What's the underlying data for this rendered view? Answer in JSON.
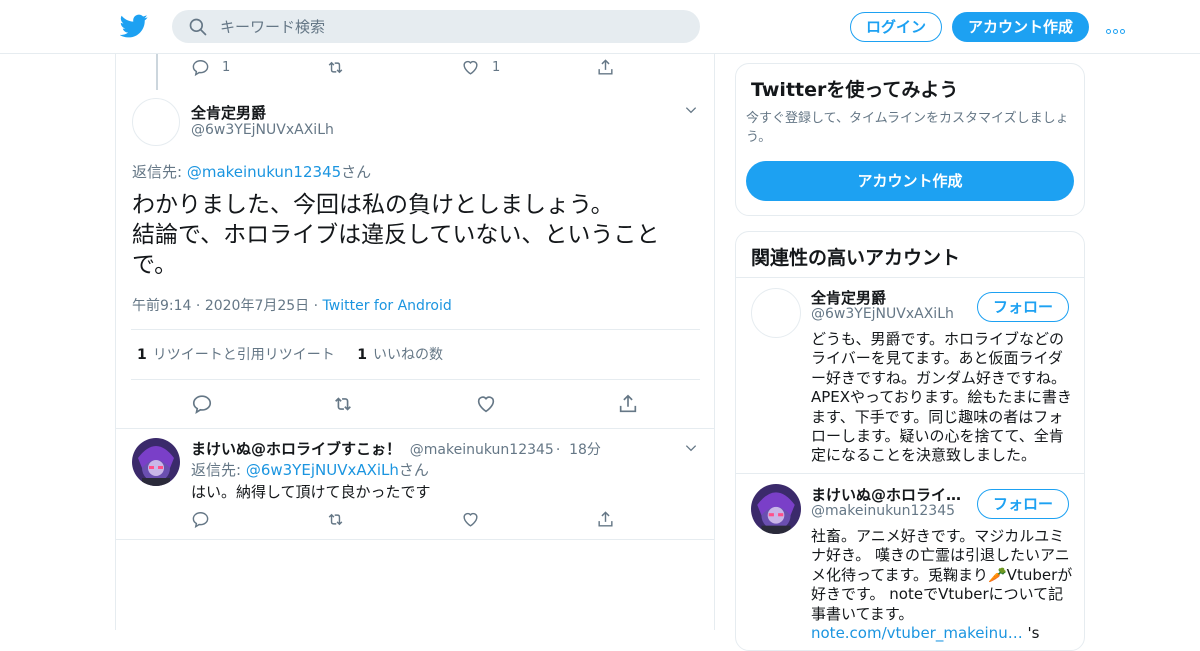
{
  "header": {
    "search_placeholder": "キーワード検索",
    "login_label": "ログイン",
    "signup_label": "アカウント作成",
    "brand_color": "#1da1f2"
  },
  "prev_tweet": {
    "reply_count": "1",
    "like_count": "1"
  },
  "tweet": {
    "name": "全肯定男爵",
    "handle": "@6w3YEjNUVxAXiLh",
    "reply_prefix": "返信先: ",
    "reply_target": "@makeinukun12345",
    "reply_suffix": "さん",
    "text": "わかりました、今回は私の負けとしましょう。\n結論で、ホロライブは違反していない、ということで。",
    "time": "午前9:14",
    "date": "2020年7月25日",
    "source": "Twitter for Android",
    "retweet_count": "1",
    "retweet_label": "リツイートと引用リツイート",
    "like_count": "1",
    "like_label": "いいねの数"
  },
  "reply": {
    "name": "まけいぬ@ホロライブすこぉ！",
    "handle": "@makeinukun12345",
    "age": "18分",
    "reply_prefix": "返信先: ",
    "reply_target": "@6w3YEjNUVxAXiLh",
    "reply_suffix": "さん",
    "text": "はい。納得して頂けて良かったです"
  },
  "sidebar": {
    "signup_card": {
      "title": "Twitterを使ってみよう",
      "subtitle": "今すぐ登録して、タイムラインをカスタマイズしましょう。",
      "button": "アカウント作成"
    },
    "related": {
      "title": "関連性の高いアカウント",
      "follow_label": "フォロー",
      "accounts": [
        {
          "name": "全肯定男爵",
          "handle": "@6w3YEjNUVxAXiLh",
          "bio": "どうも、男爵です。ホロライブなどのライバーを見てます。あと仮面ライダー好きですね。ガンダム好きですね。APEXやっております。絵もたまに書きます、下手です。同じ趣味の者はフォローします。疑いの心を捨てて、全肯定になることを決意致しました。"
        },
        {
          "name": "まけいぬ@ホロライブすこぉ！",
          "handle": "@makeinukun12345",
          "bio": "社畜。アニメ好きです。マジカルユミナ好き。 嘆きの亡霊は引退したいアニメ化待ってます。兎鞠まり🥕Vtuberが好きです。 noteでVtuberについて記事書いてま",
          "bio_tail_prefix": "す。",
          "bio_link": "note.com/vtuber_makeinu…",
          "bio_tail_suffix": " 's"
        }
      ]
    }
  }
}
